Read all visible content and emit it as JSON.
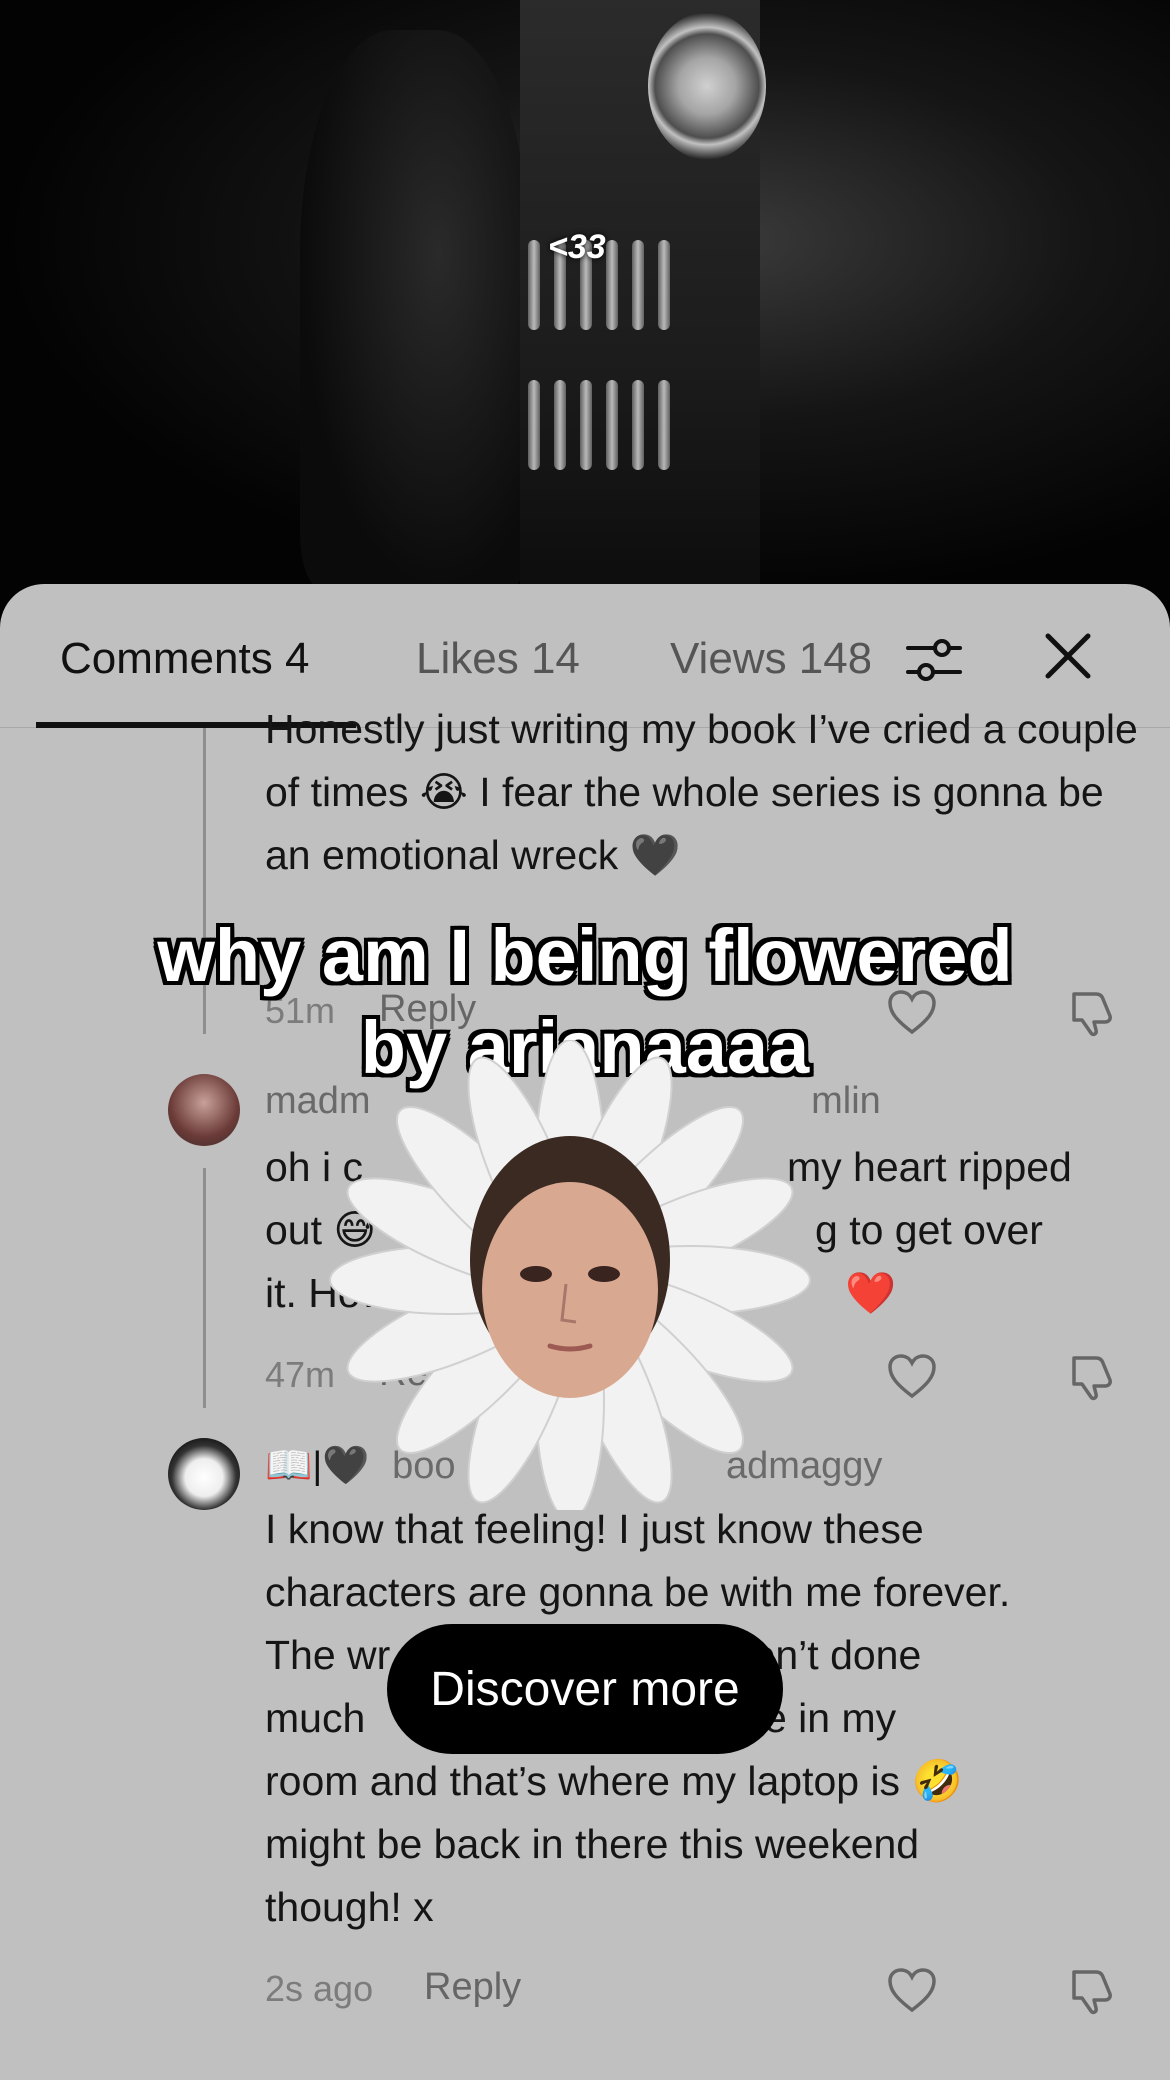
{
  "video": {
    "caption": "<33"
  },
  "tabs": {
    "comments": "Comments 4",
    "likes": "Likes 14",
    "views": "Views 148"
  },
  "icons": {
    "filter": "sliders-icon",
    "close": "close-icon",
    "like": "heart-icon",
    "dislike": "thumbs-down-icon"
  },
  "comments": [
    {
      "text": "Honestly just writing my book I’ve cried a couple of times 😭 I fear the whole series is gonna be an emotional wreck 🖤",
      "time": "51m",
      "reply": "Reply"
    },
    {
      "username": "madm",
      "username_suffix": "mlin",
      "text_lines": [
        "oh i c",
        "my heart ripped",
        "out 😅",
        "g to get over",
        "it. How",
        "❤️"
      ],
      "time": "47m",
      "reply": "Reply"
    },
    {
      "username_emoji": "📖|🖤",
      "username": "boo",
      "username_suffix": "admaggy",
      "text": "I know that feeling! I just know these characters are gonna be with me forever. The wr, haven’t done much ats are in my room and that’s where my laptop is 🤣 might be back in there this weekend though! x",
      "text_lines": [
        "I know that feeling! I just know these",
        "characters are gonna be with me forever.",
        "The wr                        , haven’t done",
        "much                          ats are in my",
        "room and that’s where my laptop is 🤣",
        "might be back in there this weekend",
        "though! x"
      ],
      "time": "2s ago",
      "reply": "Reply"
    }
  ],
  "sticker": {
    "line1": "why am I being flowered",
    "line2": "by arianaaaa"
  },
  "discover": {
    "label": "Discover more"
  },
  "colors": {
    "sheet_bg": "#c0c0c0",
    "button_bg": "#000000"
  }
}
